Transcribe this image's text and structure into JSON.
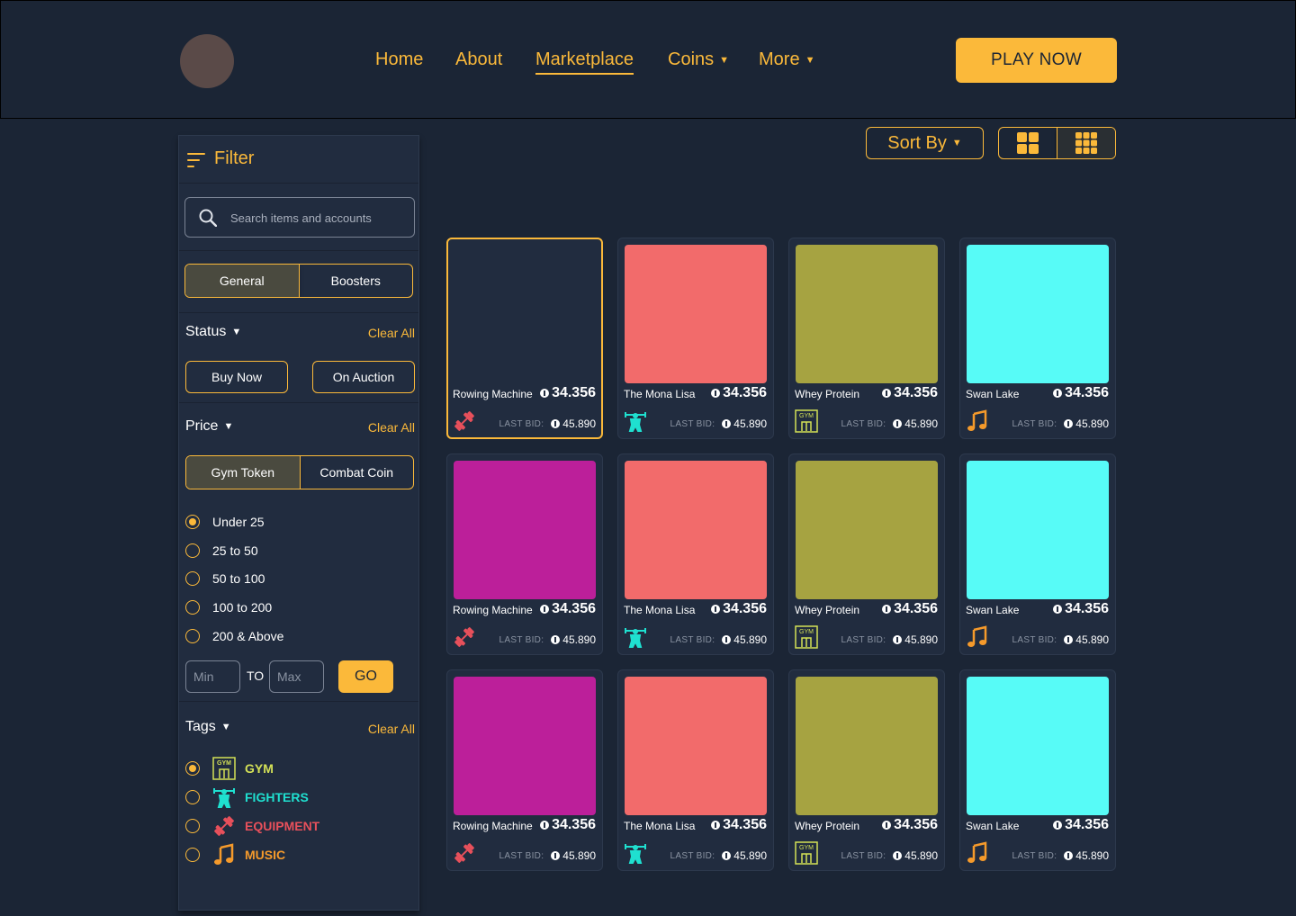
{
  "header": {
    "nav": [
      {
        "label": "Home",
        "caret": false,
        "active": false
      },
      {
        "label": "About",
        "caret": false,
        "active": false
      },
      {
        "label": "Marketplace",
        "caret": false,
        "active": true
      },
      {
        "label": "Coins",
        "caret": true,
        "active": false
      },
      {
        "label": "More",
        "caret": true,
        "active": false
      }
    ],
    "play_label": "PLAY NOW"
  },
  "sidebar": {
    "title": "Filter",
    "search_placeholder": "Search items and accounts",
    "category_tabs": [
      "General",
      "Boosters"
    ],
    "status": {
      "label": "Status",
      "clear": "Clear All",
      "buttons": [
        "Buy Now",
        "On Auction"
      ]
    },
    "price": {
      "label": "Price",
      "clear": "Clear All",
      "currency_tabs": [
        "Gym Token",
        "Combat Coin"
      ],
      "ranges": [
        "Under 25",
        "25 to 50",
        "50 to 100",
        "100 to 200",
        "200 & Above"
      ],
      "selected_range": 0,
      "min_placeholder": "Min",
      "to_label": "TO",
      "max_placeholder": "Max",
      "go_label": "GO"
    },
    "tags": {
      "label": "Tags",
      "clear": "Clear All",
      "items": [
        {
          "label": "GYM",
          "color": "#d4e157",
          "icon": "gym-icon",
          "selected": true
        },
        {
          "label": "FIGHTERS",
          "color": "#1fe0d0",
          "icon": "fighter-icon",
          "selected": false
        },
        {
          "label": "EQUIPMENT",
          "color": "#e8505b",
          "icon": "dumbbell-icon",
          "selected": false
        },
        {
          "label": "MUSIC",
          "color": "#f59a2b",
          "icon": "music-note-icon",
          "selected": false
        }
      ]
    }
  },
  "toolbar": {
    "sort_label": "Sort By"
  },
  "cards": {
    "last_bid_label": "LAST BID:",
    "columns": [
      {
        "name": "Rowing Machine",
        "color": "#bc1f9a",
        "icon": "dumbbell-icon"
      },
      {
        "name": "The Mona Lisa",
        "color": "#f26b6b",
        "icon": "fighter-icon"
      },
      {
        "name": "Whey Protein",
        "color": "#a6a341",
        "icon": "gym-icon"
      },
      {
        "name": "Swan Lake",
        "color": "#57fbf7",
        "icon": "music-note-icon"
      }
    ],
    "price": "34.356",
    "last_bid": "45.890",
    "first_image_blank": true
  },
  "colors": {
    "accent": "#fbb93a",
    "background": "#1b2535",
    "panel": "#212c3f"
  }
}
